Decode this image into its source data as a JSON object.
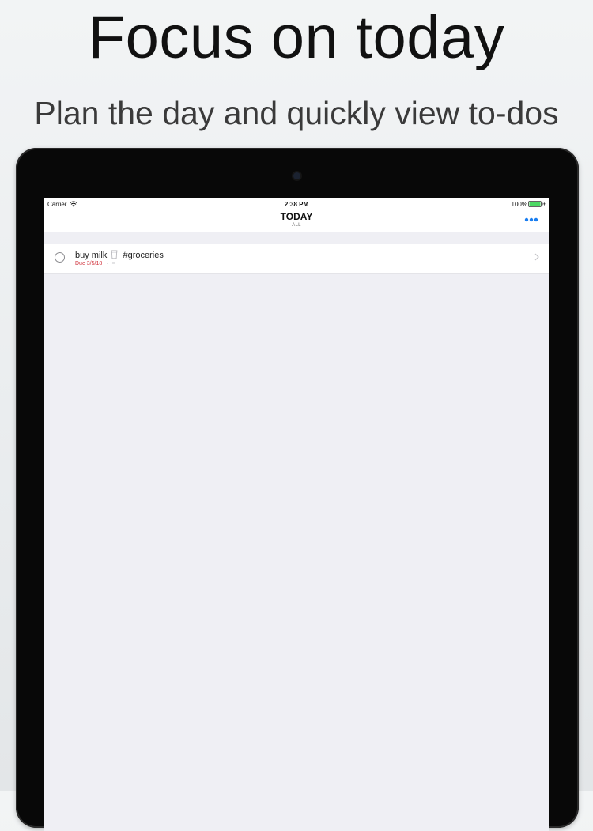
{
  "promo": {
    "headline": "Focus on today",
    "subheadline": "Plan the day and quickly view to-dos"
  },
  "statusbar": {
    "carrier": "Carrier",
    "time": "2:38 PM",
    "battery": "100%"
  },
  "navbar": {
    "title": "TODAY",
    "subtitle": "ALL",
    "more_icon": "ellipsis-icon"
  },
  "tasks": [
    {
      "title_before": "buy milk",
      "emoji_icon": "milk-cup-icon",
      "tag": "#groceries",
      "due": "Due 3/5/18",
      "separator": "·",
      "extra": "≡"
    }
  ],
  "colors": {
    "accent": "#1a7ef0",
    "due": "#d0303a",
    "battery": "#4cd964"
  }
}
